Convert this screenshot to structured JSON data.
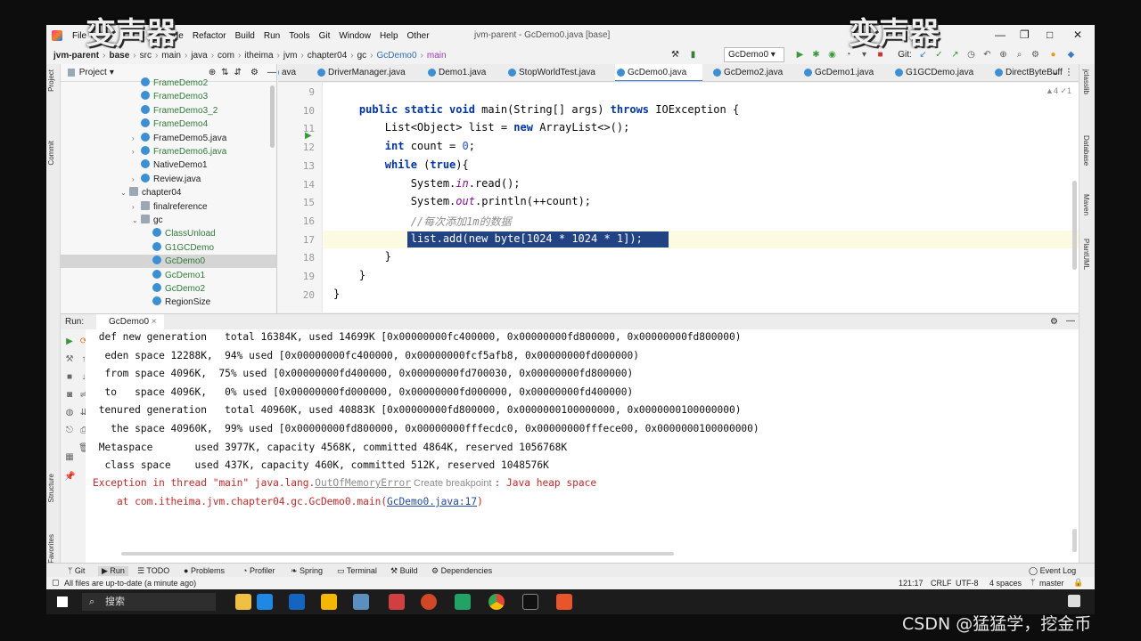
{
  "overlay": {
    "left_watermark": "变声器",
    "right_watermark": "变声器",
    "credit": "CSDN @猛猛学，挖金币"
  },
  "menu": [
    "File",
    "Edit",
    "View",
    "Navigate",
    "Code",
    "Refactor",
    "Build",
    "Run",
    "Tools",
    "Git",
    "Window",
    "Help",
    "Other"
  ],
  "visible_menu": [
    "File",
    "ode",
    "Refactor",
    "Build",
    "Run",
    "Tools",
    "Git",
    "Window",
    "Help",
    "Other"
  ],
  "window_title": "jvm-parent - GcDemo0.java [base]",
  "breadcrumbs": [
    "jvm-parent",
    "base",
    "src",
    "main",
    "java",
    "com",
    "itheima",
    "jvm",
    "chapter04",
    "gc",
    "GcDemo0",
    "main"
  ],
  "run_config": "GcDemo0",
  "git_label": "Git:",
  "project": {
    "header": "Project",
    "tree": [
      {
        "label": "FrameDemo2",
        "indent": 2,
        "kind": "class",
        "color": "#2f7a3a"
      },
      {
        "label": "FrameDemo3",
        "indent": 2,
        "kind": "class",
        "color": "#2f7a3a"
      },
      {
        "label": "FrameDemo3_2",
        "indent": 2,
        "kind": "class",
        "color": "#2f7a3a"
      },
      {
        "label": "FrameDemo4",
        "indent": 2,
        "kind": "class",
        "color": "#2f7a3a"
      },
      {
        "label": "FrameDemo5.java",
        "indent": 2,
        "kind": "class",
        "arrow": "›",
        "color": "#222"
      },
      {
        "label": "FrameDemo6.java",
        "indent": 2,
        "kind": "class",
        "arrow": "›",
        "color": "#2f7a3a"
      },
      {
        "label": "NativeDemo1",
        "indent": 2,
        "kind": "class",
        "color": "#222"
      },
      {
        "label": "Review.java",
        "indent": 2,
        "kind": "class",
        "arrow": "›",
        "color": "#222"
      },
      {
        "label": "chapter04",
        "indent": 1,
        "kind": "folder",
        "arrow": "⌄",
        "color": "#222"
      },
      {
        "label": "finalreference",
        "indent": 2,
        "kind": "folder",
        "arrow": "›",
        "color": "#222"
      },
      {
        "label": "gc",
        "indent": 2,
        "kind": "folder",
        "arrow": "⌄",
        "color": "#222"
      },
      {
        "label": "ClassUnload",
        "indent": 3,
        "kind": "class",
        "color": "#2f7a3a"
      },
      {
        "label": "G1GCDemo",
        "indent": 3,
        "kind": "class",
        "color": "#2f7a3a"
      },
      {
        "label": "GcDemo0",
        "indent": 3,
        "kind": "class",
        "color": "#2f7a3a",
        "selected": true
      },
      {
        "label": "GcDemo1",
        "indent": 3,
        "kind": "class",
        "color": "#2f7a3a"
      },
      {
        "label": "GcDemo2",
        "indent": 3,
        "kind": "class",
        "color": "#2f7a3a"
      },
      {
        "label": "RegionSize",
        "indent": 3,
        "kind": "class",
        "color": "#222"
      }
    ]
  },
  "editor_tabs": [
    "ava",
    "DriverManager.java",
    "Demo1.java",
    "StopWorldTest.java",
    "GcDemo0.java",
    "GcDemo2.java",
    "GcDemo1.java",
    "G1GCDemo.java",
    "DirectByteBuff"
  ],
  "active_tab": "GcDemo0.java",
  "inspection": "▲4 ✓1",
  "code_lines": [
    {
      "n": "9",
      "html": ""
    },
    {
      "n": "10",
      "html": "    <span class='kw'>public static void</span> main(String[] args) <span class='kw'>throws</span> IOException {"
    },
    {
      "n": "11",
      "html": "        List&lt;Object&gt; list = <span class='kw'>new</span> ArrayList&lt;&gt;();"
    },
    {
      "n": "12",
      "html": "        <span class='kw'>int</span> count = <span class='num'>0</span>;"
    },
    {
      "n": "13",
      "html": "        <span class='kw'>while</span> (<span class='kw'>true</span>){"
    },
    {
      "n": "14",
      "html": "            System.<span class='fld'>in</span>.read();"
    },
    {
      "n": "15",
      "html": "            System.<span class='fld'>out</span>.println(++count);"
    },
    {
      "n": "16",
      "html": "            <span class='cm'>//每次添加1m的数据</span>"
    },
    {
      "n": "17",
      "html": "            <span style='color:#fff'>list.add(new byte[1024 * 1024 * 1]);</span>"
    },
    {
      "n": "18",
      "html": "        }"
    },
    {
      "n": "19",
      "html": "    }"
    },
    {
      "n": "20",
      "html": "}"
    }
  ],
  "run": {
    "label": "Run:",
    "tab": "GcDemo0"
  },
  "console_lines": [
    {
      "cls": "",
      "text": " def new generation   total 16384K, used 14699K [0x00000000fc400000, 0x00000000fd800000, 0x00000000fd800000)"
    },
    {
      "cls": "",
      "text": "  eden space 12288K,  94% used [0x00000000fc400000, 0x00000000fcf5afb8, 0x00000000fd000000)"
    },
    {
      "cls": "",
      "text": "  from space 4096K,  75% used [0x00000000fd400000, 0x00000000fd700030, 0x00000000fd800000)"
    },
    {
      "cls": "",
      "text": "  to   space 4096K,   0% used [0x00000000fd000000, 0x00000000fd000000, 0x00000000fd400000)"
    },
    {
      "cls": "",
      "text": " tenured generation   total 40960K, used 40883K [0x00000000fd800000, 0x0000000100000000, 0x0000000100000000)"
    },
    {
      "cls": "",
      "text": "   the space 40960K,  99% used [0x00000000fd800000, 0x00000000fffecdc0, 0x00000000fffece00, 0x0000000100000000)"
    },
    {
      "cls": "",
      "text": " Metaspace       used 3977K, capacity 4568K, committed 4864K, reserved 1056768K"
    },
    {
      "cls": "",
      "text": "  class space    used 437K, capacity 460K, committed 512K, reserved 1048576K"
    }
  ],
  "exception": {
    "prefix": "Exception in thread \"main\" java.lang.",
    "error_name": "OutOfMemoryError",
    "breakpoint": " Create breakpoint ",
    "suffix": ": Java heap space",
    "at_prefix": "    at com.itheima.jvm.chapter04.gc.GcDemo0.main(",
    "at_link": "GcDemo0.java:17",
    "at_suffix": ")"
  },
  "bottom_tabs": [
    "Git",
    "Run",
    "TODO",
    "Problems",
    "Profiler",
    "Spring",
    "Terminal",
    "Build",
    "Dependencies"
  ],
  "event_log": "Event Log",
  "status": {
    "message": "All files are up-to-date (a minute ago)",
    "position": "121:17",
    "line_sep": "CRLF",
    "encoding": "UTF-8",
    "indent": "4 spaces",
    "branch": "master"
  },
  "taskbar": {
    "search": "搜索"
  },
  "left_stripe": [
    "Project",
    "Commit",
    "Structure",
    "Favorites"
  ],
  "right_stripe": [
    "jclasslib",
    "Database",
    "Maven",
    "PlantUML"
  ]
}
